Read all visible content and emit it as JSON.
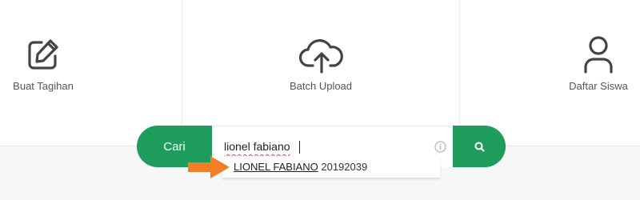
{
  "menu": {
    "items": [
      {
        "label": "Buat Tagihan",
        "icon": "edit-icon"
      },
      {
        "label": "Batch Upload",
        "icon": "cloud-upload-icon"
      },
      {
        "label": "Daftar Siswa",
        "icon": "user-icon"
      }
    ]
  },
  "search": {
    "button_label": "Cari",
    "value": "lionel fabiano",
    "submit_icon": "search-icon",
    "info_icon": "info-icon",
    "suggestion": {
      "name": "LIONEL FABIANO",
      "id": "20192039"
    }
  },
  "colors": {
    "accent": "#1f9d5c",
    "arrow": "#f07f28",
    "text": "#555555"
  }
}
